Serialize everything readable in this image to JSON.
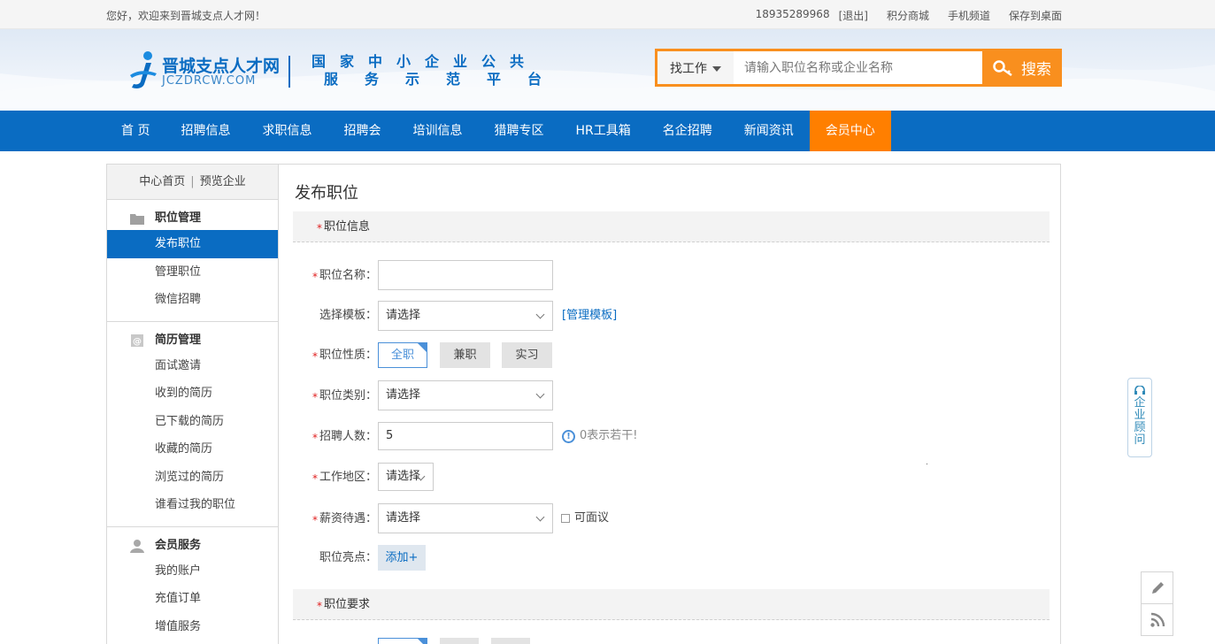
{
  "topbar": {
    "welcome": "您好，欢迎来到晋城支点人才网！",
    "phone": "18935289968",
    "logout": "[退出]",
    "links": [
      "积分商城",
      "手机频道",
      "保存到桌面"
    ]
  },
  "header": {
    "logo_cn": "晋城支点人才网",
    "logo_en": "JCZDRCW.COM",
    "slogan_line1": "国家中小企业公共",
    "slogan_line2": "服务示范平台"
  },
  "search": {
    "type": "找工作",
    "placeholder": "请输入职位名称或企业名称",
    "button": "搜索"
  },
  "nav": {
    "items": [
      "首 页",
      "招聘信息",
      "求职信息",
      "招聘会",
      "培训信息",
      "猎聘专区",
      "HR工具箱",
      "名企招聘",
      "新闻资讯",
      "会员中心"
    ],
    "active": "会员中心"
  },
  "sidebar": {
    "top_links": [
      "中心首页",
      "预览企业"
    ],
    "groups": [
      {
        "title": "职位管理",
        "icon": "folder-icon",
        "items": [
          "发布职位",
          "管理职位",
          "微信招聘"
        ]
      },
      {
        "title": "简历管理",
        "icon": "resume-icon",
        "items": [
          "面试邀请",
          "收到的简历",
          "已下载的简历",
          "收藏的简历",
          "浏览过的简历",
          "谁看过我的职位"
        ]
      },
      {
        "title": "会员服务",
        "icon": "user-icon",
        "items": [
          "我的账户",
          "充值订单",
          "增值服务"
        ]
      }
    ],
    "active_item": "发布职位"
  },
  "form": {
    "page_title": "发布职位",
    "section1": "职位信息",
    "section2": "职位要求",
    "job_name_label": "职位名称：",
    "job_name_value": "",
    "template_label": "选择模板：",
    "template_value": "请选择",
    "template_link": "[管理模板]",
    "nature_label": "职位性质：",
    "nature_options": [
      "全职",
      "兼职",
      "实习"
    ],
    "nature_selected": "全职",
    "category_label": "职位类别：",
    "category_value": "请选择",
    "count_label": "招聘人数：",
    "count_value": "5",
    "count_hint": "0表示若干!",
    "area_label": "工作地区：",
    "area_value": "请选择",
    "salary_label": "薪资待遇：",
    "salary_value": "请选择",
    "negotiable": "可面议",
    "highlight_label": "职位亮点：",
    "add_button": "添加+"
  },
  "float": {
    "advisor": "企业顾问"
  },
  "colors": {
    "brand_blue": "#0a6cc2",
    "nav_active": "#ff7f00",
    "search_orange": "#f98f1e"
  }
}
